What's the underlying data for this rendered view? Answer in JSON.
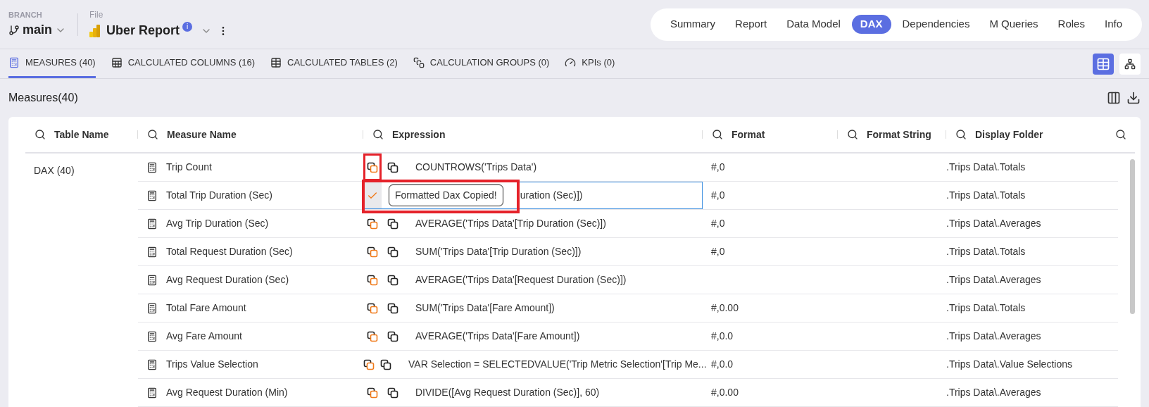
{
  "header": {
    "branch_label": "BRANCH",
    "branch": "main",
    "file_label": "File",
    "file_name": "Uber Report",
    "info_badge": "i"
  },
  "nav": [
    {
      "label": "Summary",
      "selected": false
    },
    {
      "label": "Report",
      "selected": false
    },
    {
      "label": "Data Model",
      "selected": false
    },
    {
      "label": "DAX",
      "selected": true
    },
    {
      "label": "Dependencies",
      "selected": false
    },
    {
      "label": "M Queries",
      "selected": false
    },
    {
      "label": "Roles",
      "selected": false
    },
    {
      "label": "Info",
      "selected": false
    }
  ],
  "tabs": [
    {
      "label": "MEASURES (40)",
      "kind": "measures",
      "selected": true
    },
    {
      "label": "CALCULATED COLUMNS (16)",
      "kind": "columns",
      "selected": false
    },
    {
      "label": "CALCULATED TABLES (2)",
      "kind": "tables",
      "selected": false
    },
    {
      "label": "CALCULATION GROUPS (0)",
      "kind": "groups",
      "selected": false
    },
    {
      "label": "KPIs (0)",
      "kind": "kpis",
      "selected": false
    }
  ],
  "view_toggle": [
    {
      "kind": "grid",
      "selected": true
    },
    {
      "kind": "diagram",
      "selected": false
    }
  ],
  "section_title": "Measures(40)",
  "table": {
    "columns": [
      "Table Name",
      "Measure Name",
      "Expression",
      "Format",
      "Format String",
      "Display Folder"
    ],
    "group": "DAX (40)",
    "rows": [
      {
        "measure": "Trip Count",
        "expression": "COUNTROWS('Trips Data')",
        "format": "#,0",
        "display_folder": ".Trips Data\\.Totals",
        "icon_highlight": true
      },
      {
        "measure": "Total Trip Duration (Sec)",
        "expression": "uration (Sec)])",
        "format": "#,0",
        "display_folder": ".Trips Data\\.Totals",
        "cell_highlight": true,
        "copied": true,
        "focused": true,
        "tooltip": "Formatted Dax Copied!"
      },
      {
        "measure": "Avg Trip Duration (Sec)",
        "expression": "AVERAGE('Trips Data'[Trip Duration (Sec)])",
        "format": "#,0",
        "display_folder": ".Trips Data\\.Averages"
      },
      {
        "measure": "Total Request Duration (Sec)",
        "expression": "SUM('Trips Data'[Trip Duration (Sec)])",
        "format": "#,0",
        "display_folder": ".Trips Data\\.Totals"
      },
      {
        "measure": "Avg Request Duration (Sec)",
        "expression": "AVERAGE('Trips Data'[Request Duration (Sec)])",
        "format": "",
        "display_folder": ".Trips Data\\.Averages"
      },
      {
        "measure": "Total Fare Amount",
        "expression": "SUM('Trips Data'[Fare Amount])",
        "format": "#,0.00",
        "display_folder": ".Trips Data\\.Totals"
      },
      {
        "measure": "Avg Fare Amount",
        "expression": "AVERAGE('Trips Data'[Fare Amount])",
        "format": "#,0.0",
        "display_folder": ".Trips Data\\.Averages"
      },
      {
        "measure": "Trips Value Selection",
        "expression": "VAR Selection = SELECTEDVALUE('Trip Metric Selection'[Trip Me...",
        "format": "#,0.0",
        "display_folder": ".Trips Data\\.Value Selections"
      },
      {
        "measure": "Avg Request Duration (Min)",
        "expression": "DIVIDE([Avg Request Duration (Sec)], 60)",
        "format": "#,0.00",
        "display_folder": ".Trips Data\\.Averages"
      }
    ]
  }
}
